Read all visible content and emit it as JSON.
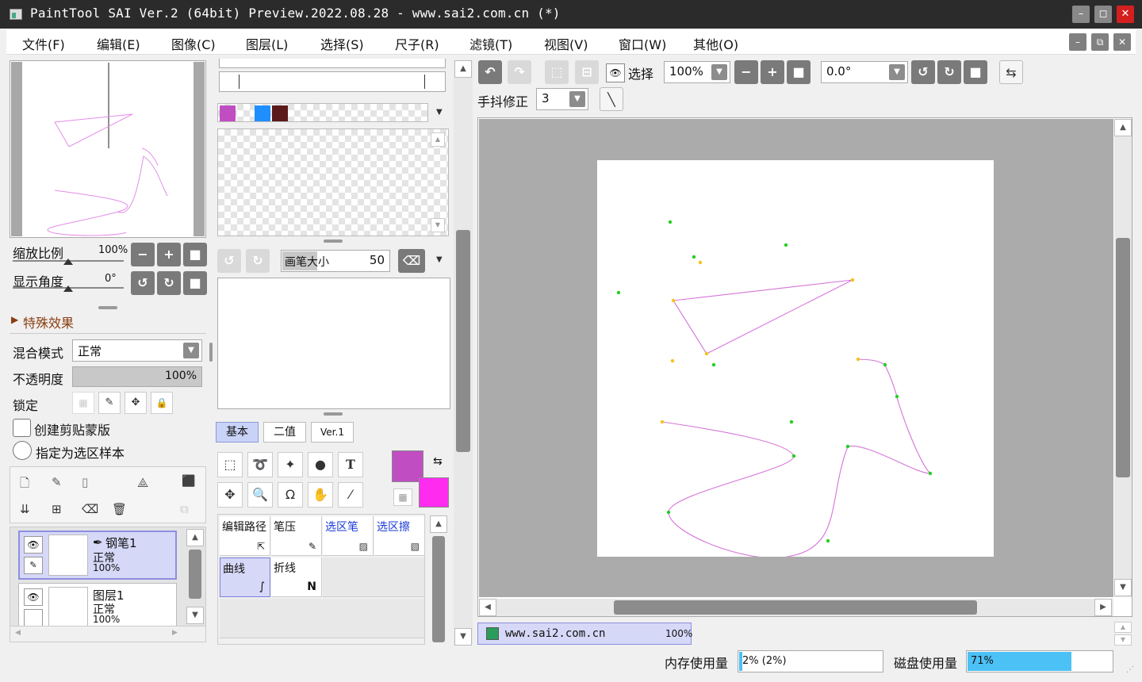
{
  "window": {
    "title": "PaintTool SAI Ver.2 (64bit) Preview.2022.08.28 - www.sai2.com.cn (*)",
    "minimize": "–",
    "maximize": "◻",
    "close": "✕"
  },
  "menu": [
    "文件(F)",
    "编辑(E)",
    "图像(C)",
    "图层(L)",
    "选择(S)",
    "尺子(R)",
    "滤镜(T)",
    "视图(V)",
    "窗口(W)",
    "其他(O)"
  ],
  "navigator": {
    "zoom_label": "缩放比例",
    "zoom_value": "100%",
    "angle_label": "显示角度",
    "angle_value": "0°"
  },
  "effects": {
    "label": "特殊效果"
  },
  "layer_props": {
    "blend_label": "混合模式",
    "blend_value": "正常",
    "opacity_label": "不透明度",
    "opacity_value": "100%",
    "lock_label": "锁定",
    "clip_label": "创建剪贴蒙版",
    "selection_source_label": "指定为选区样本"
  },
  "layers": [
    {
      "name": "钢笔1",
      "mode": "正常",
      "opacity": "100%",
      "selected": true
    },
    {
      "name": "图层1",
      "mode": "正常",
      "opacity": "100%",
      "selected": false
    }
  ],
  "swatches": {
    "colors": [
      "#c04ec2",
      "#1f8fff",
      "#5a1a1a"
    ]
  },
  "brush_size": {
    "label": "画笔大小",
    "value": "50"
  },
  "tool_tabs": [
    "基本",
    "二值",
    "Ver.1"
  ],
  "colors": {
    "primary": "#c04ec2",
    "secondary": "#ff2cf0"
  },
  "brush_tools": [
    {
      "label": "编辑路径",
      "blue": false,
      "selected": false
    },
    {
      "label": "笔压",
      "blue": false,
      "selected": false
    },
    {
      "label": "选区笔",
      "blue": true,
      "selected": false
    },
    {
      "label": "选区擦",
      "blue": true,
      "selected": false
    },
    {
      "label": "曲线",
      "blue": false,
      "selected": true
    },
    {
      "label": "折线",
      "blue": false,
      "selected": false
    }
  ],
  "canvas_toolbar": {
    "select_label": "选择",
    "zoom_value": "100%",
    "angle_value": "0.0°",
    "stabilizer_label": "手抖修正",
    "stabilizer_value": "3"
  },
  "document": {
    "name": "www.sai2.com.cn",
    "zoom": "100%"
  },
  "status": {
    "memory_label": "内存使用量",
    "memory_value": "2% (2%)",
    "memory_percent": 2,
    "disk_label": "磁盘使用量",
    "disk_value": "71%",
    "disk_percent": 71
  },
  "accent": "#4cc1f5"
}
